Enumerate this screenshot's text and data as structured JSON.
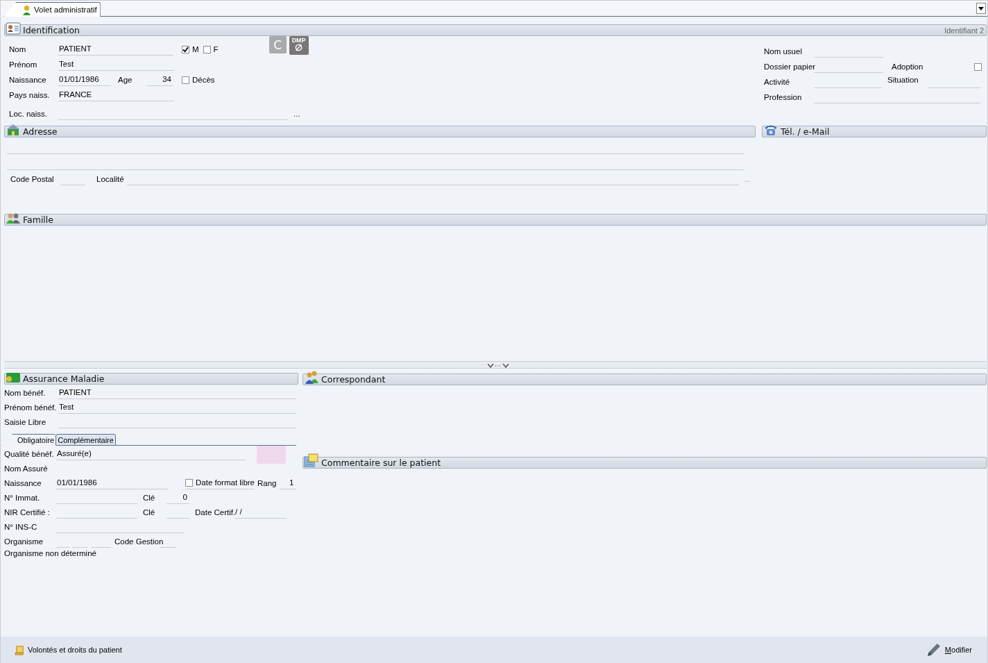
{
  "tab_bar": {
    "tabs": [
      {
        "label": "Volet administratif",
        "selected": true
      }
    ]
  },
  "identification": {
    "title": "Identification",
    "badge": "Identifiant 2",
    "name": {
      "label": "Nom",
      "value": "PATIENT"
    },
    "sex": [
      {
        "label": "M",
        "checked": true
      },
      {
        "label": "F",
        "checked": false
      }
    ],
    "first_name": {
      "label": "Prénom",
      "value": "Test"
    },
    "birth": {
      "label": "Naissance",
      "value": "01/01/1986"
    },
    "age": {
      "label": "Age",
      "value": "34"
    },
    "deceased": {
      "label": "Décès",
      "checked": false
    },
    "birth_country": {
      "label": "Pays naiss.",
      "value": "FRANCE"
    },
    "birth_place": {
      "label": "Loc. naiss.",
      "button": "..."
    },
    "c_button": "C",
    "dmp_button": "DMP",
    "usual_name": {
      "label": "Nom usuel"
    },
    "paper_file": {
      "label": "Dossier papier"
    },
    "adoption": {
      "label": "Adoption",
      "checked": false
    },
    "activity": {
      "label": "Activité"
    },
    "situation": {
      "label": "Situation"
    },
    "profession": {
      "label": "Profession"
    }
  },
  "address": {
    "title": "Adresse",
    "postal_code": {
      "label": "Code Postal"
    },
    "city": {
      "label": "Localité",
      "button": "..."
    }
  },
  "contact": {
    "title": "Tél. / e-Mail"
  },
  "family": {
    "title": "Famille"
  },
  "insurance": {
    "title": "Assurance Maladie",
    "fields": [
      {
        "label": "Nom bénéf.",
        "value": "PATIENT"
      },
      {
        "label": "Prénom bénéf.",
        "value": "Test"
      },
      {
        "label": "Saisie Libre"
      }
    ],
    "tabs": [
      {
        "label": "Obligatoire",
        "selected": true
      },
      {
        "label": "Complémentaire",
        "selected": false
      }
    ],
    "quality": {
      "label": "Qualité bénéf.",
      "value": "Assuré(e)"
    },
    "insured_name": {
      "label": "Nom Assuré"
    },
    "birth": {
      "label": "Naissance",
      "value": "01/01/1986"
    },
    "free_date": {
      "label": "Date format libre",
      "checked": false
    },
    "rank": {
      "label": "Rang",
      "value": "1"
    },
    "immat": {
      "label": "N° Immat."
    },
    "key": {
      "label": "Clé",
      "value": "0"
    },
    "nir": {
      "label": "NIR Certifié :"
    },
    "nir_key": {
      "label": "Clé"
    },
    "cert_date": {
      "label": "Date Certif.",
      "value": "/ /"
    },
    "ins_c": {
      "label": "N° INS-C"
    },
    "organism": {
      "label": "Organisme"
    },
    "code_gestion": {
      "label": "Code Gestion"
    },
    "note": "Organisme non déterminé"
  },
  "correspondent": {
    "title": "Correspondant"
  },
  "comment": {
    "title": "Commentaire sur le patient"
  },
  "footer": {
    "left_button": "Volontés et droits du patient",
    "right_button": "Modifier"
  }
}
